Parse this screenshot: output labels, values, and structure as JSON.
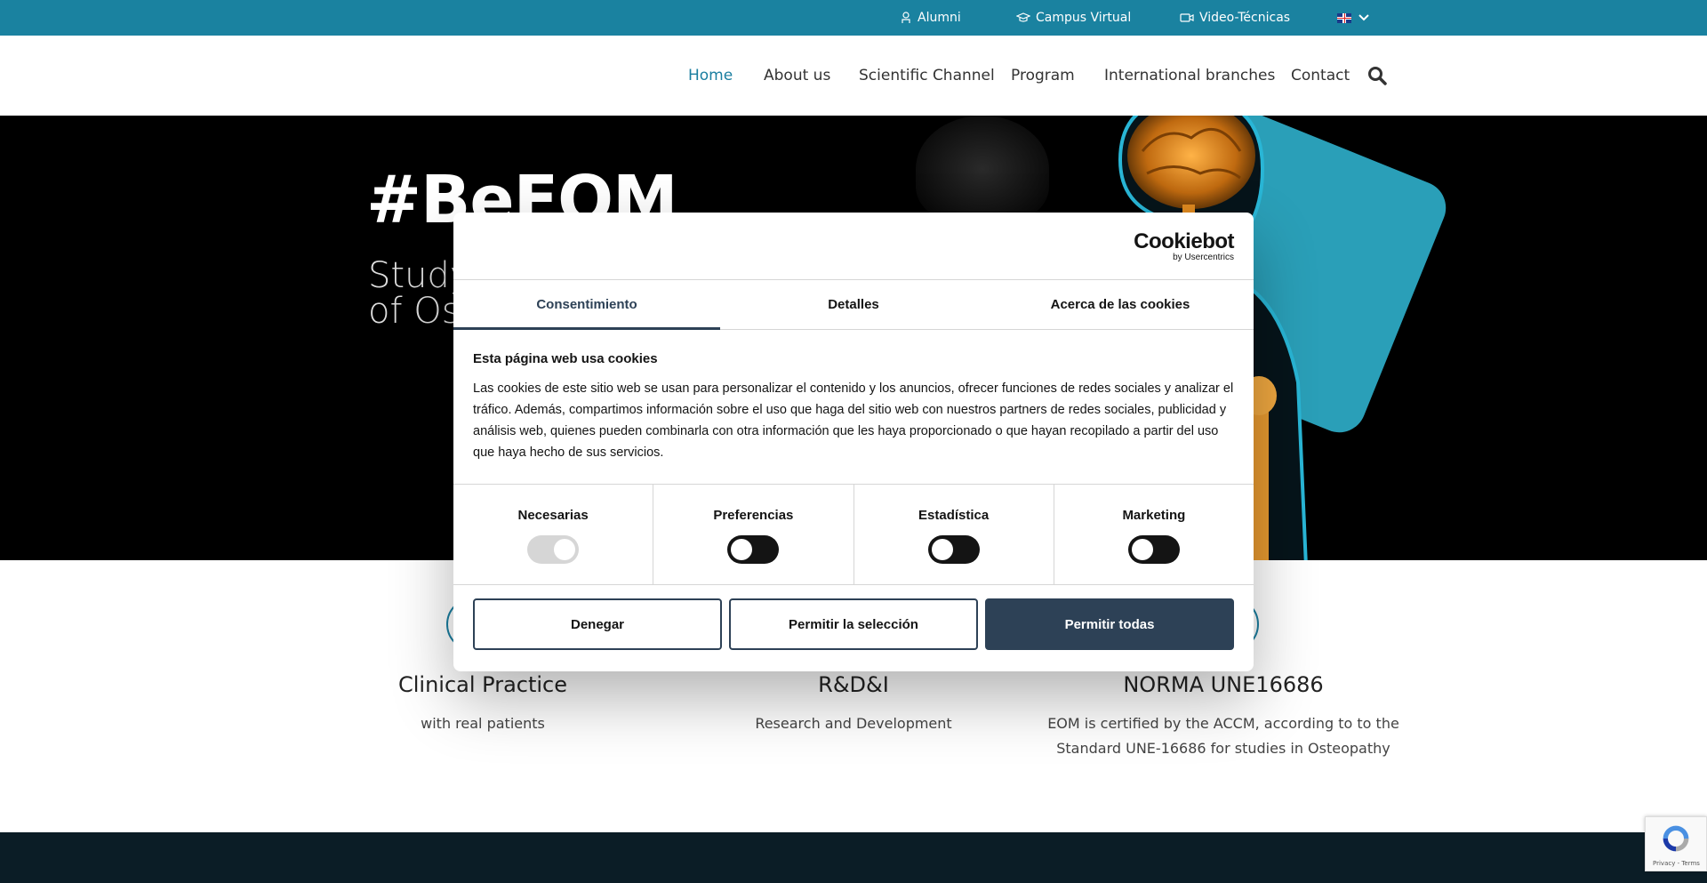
{
  "topbar": {
    "links": [
      {
        "label": "Alumni",
        "icon": "alumni-icon"
      },
      {
        "label": "Campus Virtual",
        "icon": "graduation-cap-icon"
      },
      {
        "label": "Video-Técnicas",
        "icon": "video-camera-icon"
      }
    ],
    "language_icon": "uk-flag-icon"
  },
  "nav": {
    "items": [
      "Home",
      "About us",
      "Scientific Channel",
      "Program",
      "International branches",
      "Contact"
    ],
    "active": "Home"
  },
  "hero": {
    "title": "#BeEOM",
    "subtitle_line1": "Study",
    "subtitle_line2": "of Os"
  },
  "features": [
    {
      "title": "Clinical Practice",
      "text": "with real patients"
    },
    {
      "title": "R&D&I",
      "text": "Research and Development"
    },
    {
      "title": "NORMA UNE16686",
      "text_line1": "EOM is certified by the ACCM, according to to the",
      "text_line2": "Standard UNE-16686 for studies in Osteopathy"
    }
  ],
  "cookie_dialog": {
    "logo": "Cookiebot",
    "logo_sub": "by Usercentrics",
    "tabs": [
      "Consentimiento",
      "Detalles",
      "Acerca de las cookies"
    ],
    "active_tab": "Consentimiento",
    "heading": "Esta página web usa cookies",
    "body": "Las cookies de este sitio web se usan para personalizar el contenido y los anuncios, ofrecer funciones de redes sociales y analizar el tráfico. Además, compartimos información sobre el uso que haga del sitio web con nuestros partners de redes sociales, publicidad y análisis web, quienes pueden combinarla con otra información que les haya proporcionado o que hayan recopilado a partir del uso que haya hecho de sus servicios.",
    "toggles": [
      {
        "label": "Necesarias",
        "on": true,
        "disabled": true
      },
      {
        "label": "Preferencias",
        "on": false
      },
      {
        "label": "Estadística",
        "on": false
      },
      {
        "label": "Marketing",
        "on": false
      }
    ],
    "buttons": {
      "deny": "Denegar",
      "allow_selection": "Permitir la selección",
      "allow_all": "Permitir todas"
    }
  },
  "recaptcha": {
    "links": "Privacy - Terms"
  },
  "colors": {
    "topbar": "#1a82a0",
    "accent": "#1a7ea0",
    "dialog_primary": "#2d4156",
    "teal_card": "#2a9fb8"
  }
}
